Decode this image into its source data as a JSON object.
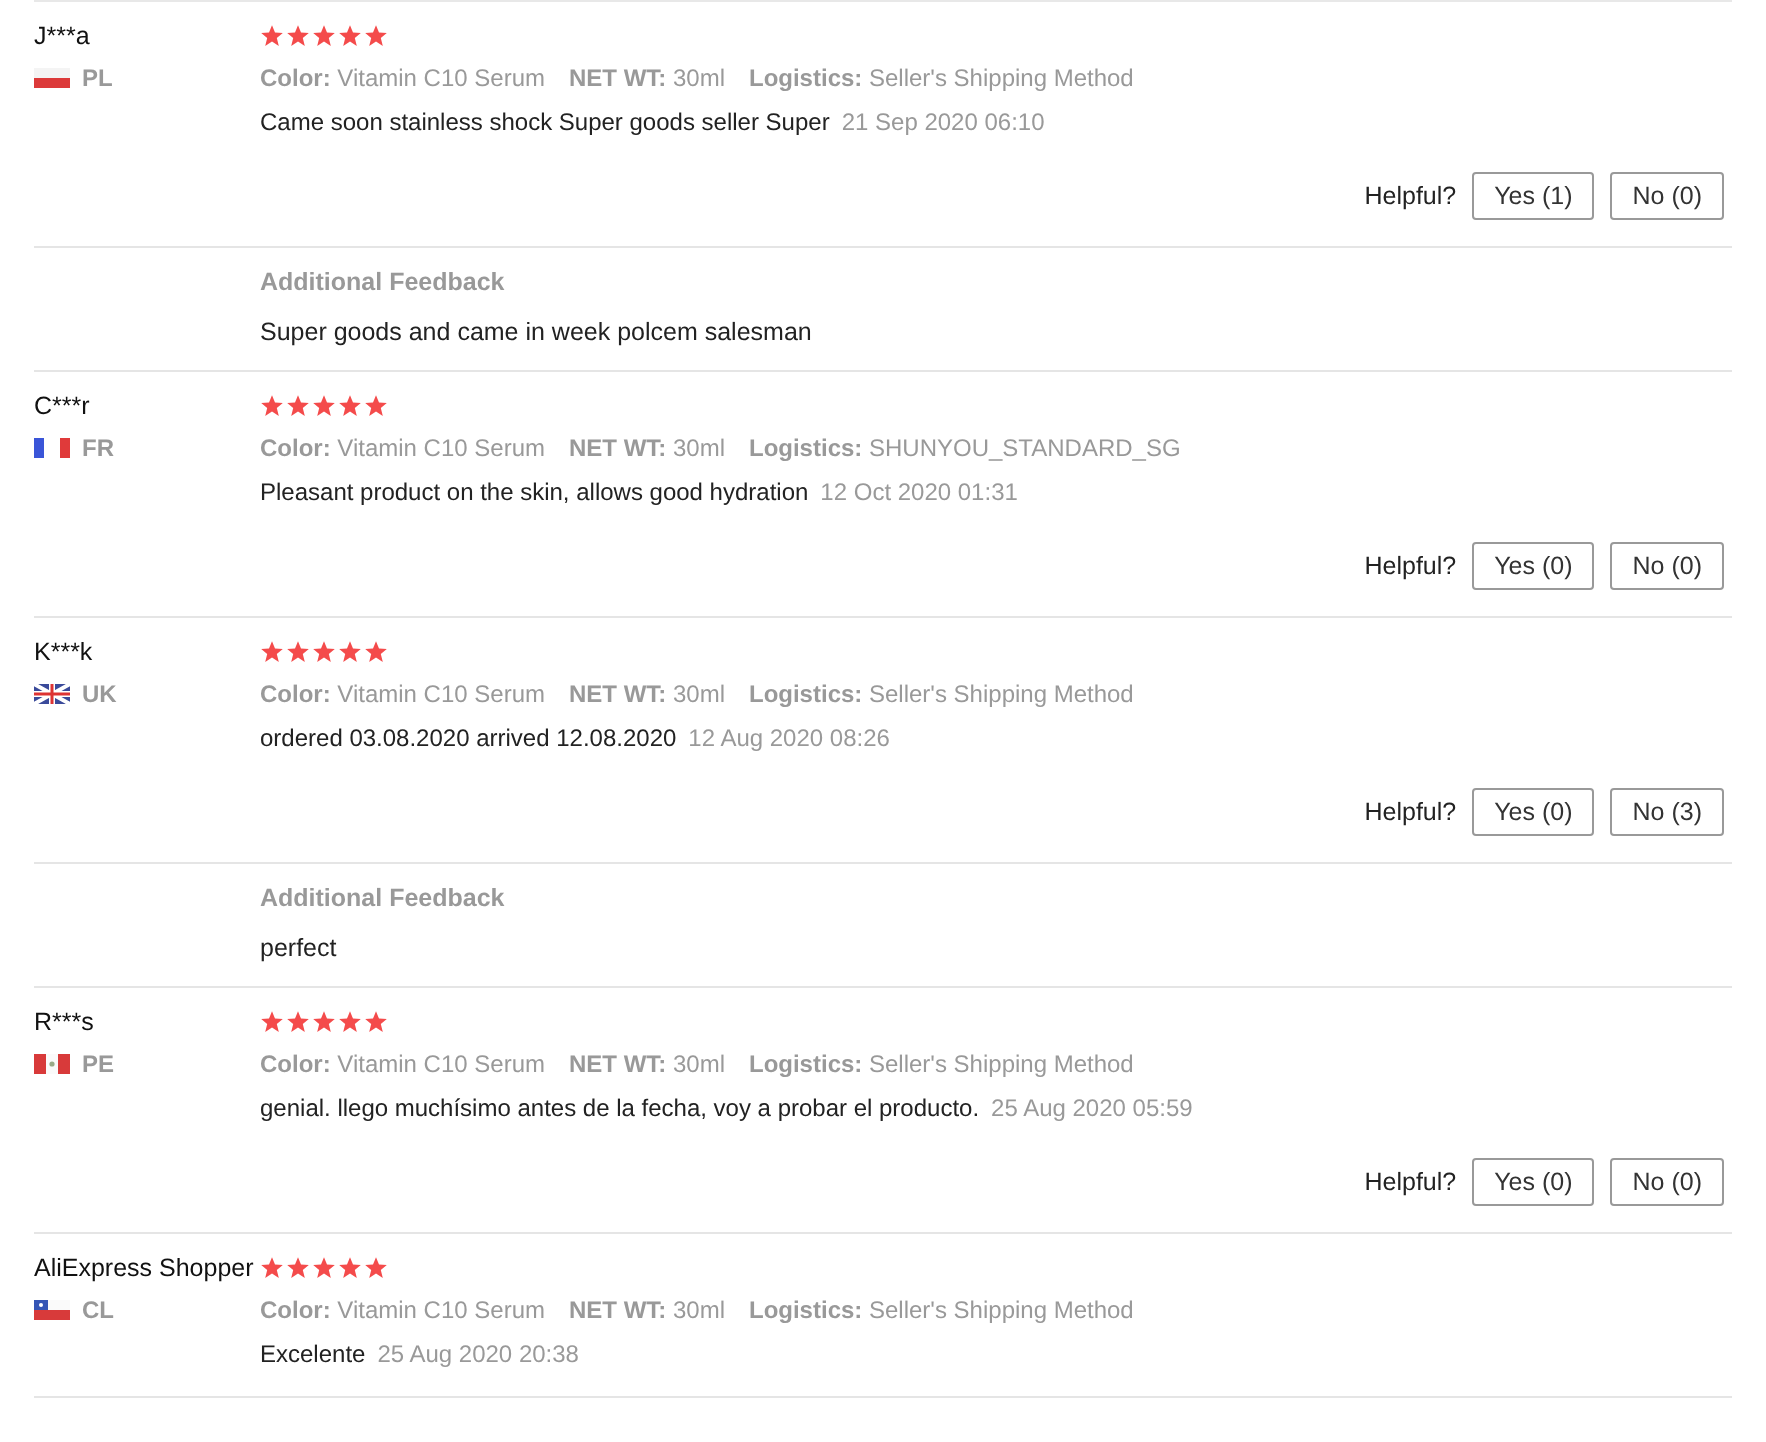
{
  "reviews": [
    {
      "name": "J***a",
      "kind": "pl",
      "country": "PL",
      "stars": 5,
      "attributes": [
        {
          "label": "Color:",
          "value": "Vitamin C10 Serum"
        },
        {
          "label": "NET WT:",
          "value": "30ml"
        },
        {
          "label": "Logistics:",
          "value": "Seller's Shipping Method"
        }
      ],
      "comment": "Came soon stainless shock Super goods seller Super",
      "date": "21 Sep 2020 06:10",
      "helpful": {
        "label": "Helpful?",
        "yes": "Yes (1)",
        "no": "No (0)"
      },
      "additional_feedback": {
        "title": "Additional Feedback",
        "text": "Super goods and came in week polcem salesman"
      }
    },
    {
      "name": "C***r",
      "kind": "fr",
      "country": "FR",
      "stars": 5,
      "attributes": [
        {
          "label": "Color:",
          "value": "Vitamin C10 Serum"
        },
        {
          "label": "NET WT:",
          "value": "30ml"
        },
        {
          "label": "Logistics:",
          "value": "SHUNYOU_STANDARD_SG"
        }
      ],
      "comment": "Pleasant product on the skin, allows good hydration",
      "date": "12 Oct 2020 01:31",
      "helpful": {
        "label": "Helpful?",
        "yes": "Yes (0)",
        "no": "No (0)"
      }
    },
    {
      "name": "K***k",
      "kind": "uk",
      "country": "UK",
      "stars": 5,
      "attributes": [
        {
          "label": "Color:",
          "value": "Vitamin C10 Serum"
        },
        {
          "label": "NET WT:",
          "value": "30ml"
        },
        {
          "label": "Logistics:",
          "value": "Seller's Shipping Method"
        }
      ],
      "comment": "ordered 03.08.2020 arrived 12.08.2020",
      "date": "12 Aug 2020 08:26",
      "helpful": {
        "label": "Helpful?",
        "yes": "Yes (0)",
        "no": "No (3)"
      },
      "additional_feedback": {
        "title": "Additional Feedback",
        "text": "perfect"
      }
    },
    {
      "name": "R***s",
      "kind": "pe",
      "country": "PE",
      "stars": 5,
      "attributes": [
        {
          "label": "Color:",
          "value": "Vitamin C10 Serum"
        },
        {
          "label": "NET WT:",
          "value": "30ml"
        },
        {
          "label": "Logistics:",
          "value": "Seller's Shipping Method"
        }
      ],
      "comment": "genial. llego muchísimo antes de la fecha, voy a probar el producto.",
      "date": "25 Aug 2020 05:59",
      "helpful": {
        "label": "Helpful?",
        "yes": "Yes (0)",
        "no": "No (0)"
      }
    },
    {
      "name": "AliExpress Shopper",
      "kind": "cl",
      "country": "CL",
      "stars": 5,
      "attributes": [
        {
          "label": "Color:",
          "value": "Vitamin C10 Serum"
        },
        {
          "label": "NET WT:",
          "value": "30ml"
        },
        {
          "label": "Logistics:",
          "value": "Seller's Shipping Method"
        }
      ],
      "comment": "Excelente",
      "date": "25 Aug 2020 20:38"
    }
  ]
}
